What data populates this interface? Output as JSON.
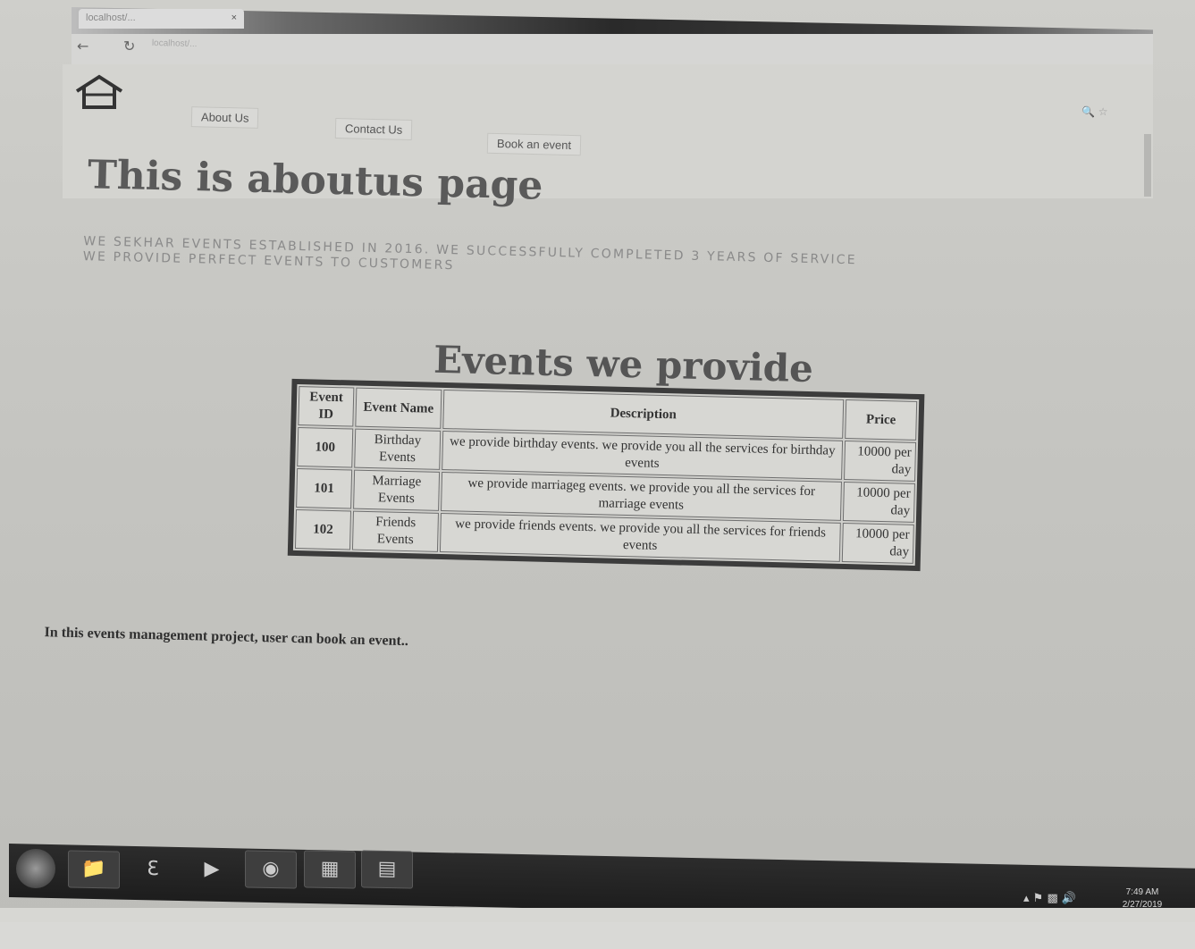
{
  "browser": {
    "tab_title": "localhost/...",
    "tab_close": "×",
    "url": "localhost/..."
  },
  "nav": {
    "about_label": "About Us",
    "contact_label": "Contact Us",
    "book_label": "Book an event"
  },
  "page": {
    "title": "This is aboutus page",
    "about_line1": "WE SEKHAR EVENTS ESTABLISHED IN 2016. WE SUCCESSFULLY COMPLETED 3 YEARS OF SERVICE",
    "about_line2": "WE PROVIDE PERFECT EVENTS TO CUSTOMERS",
    "events_title": "Events we provide",
    "footer": "In this events management project, user can book an event.."
  },
  "table": {
    "headers": [
      "Event ID",
      "Event Name",
      "Description",
      "Price"
    ],
    "rows": [
      {
        "id": "100",
        "name": "Birthday Events",
        "description": "we provide birthday events. we provide you all the services for birthday events",
        "price": "10000 per day"
      },
      {
        "id": "101",
        "name": "Marriage Events",
        "description": "we provide marriageg events. we provide you all the services for marriage events",
        "price": "10000 per day"
      },
      {
        "id": "102",
        "name": "Friends Events",
        "description": "we provide friends events. we provide you all the services for friends events",
        "price": "10000 per day"
      }
    ]
  },
  "taskbar": {
    "time": "7:49 AM",
    "date": "2/27/2019",
    "icons": [
      "start-orb-icon",
      "file-explorer-icon",
      "internet-explorer-icon",
      "media-player-icon",
      "chrome-icon",
      "app-icon",
      "document-icon"
    ]
  }
}
